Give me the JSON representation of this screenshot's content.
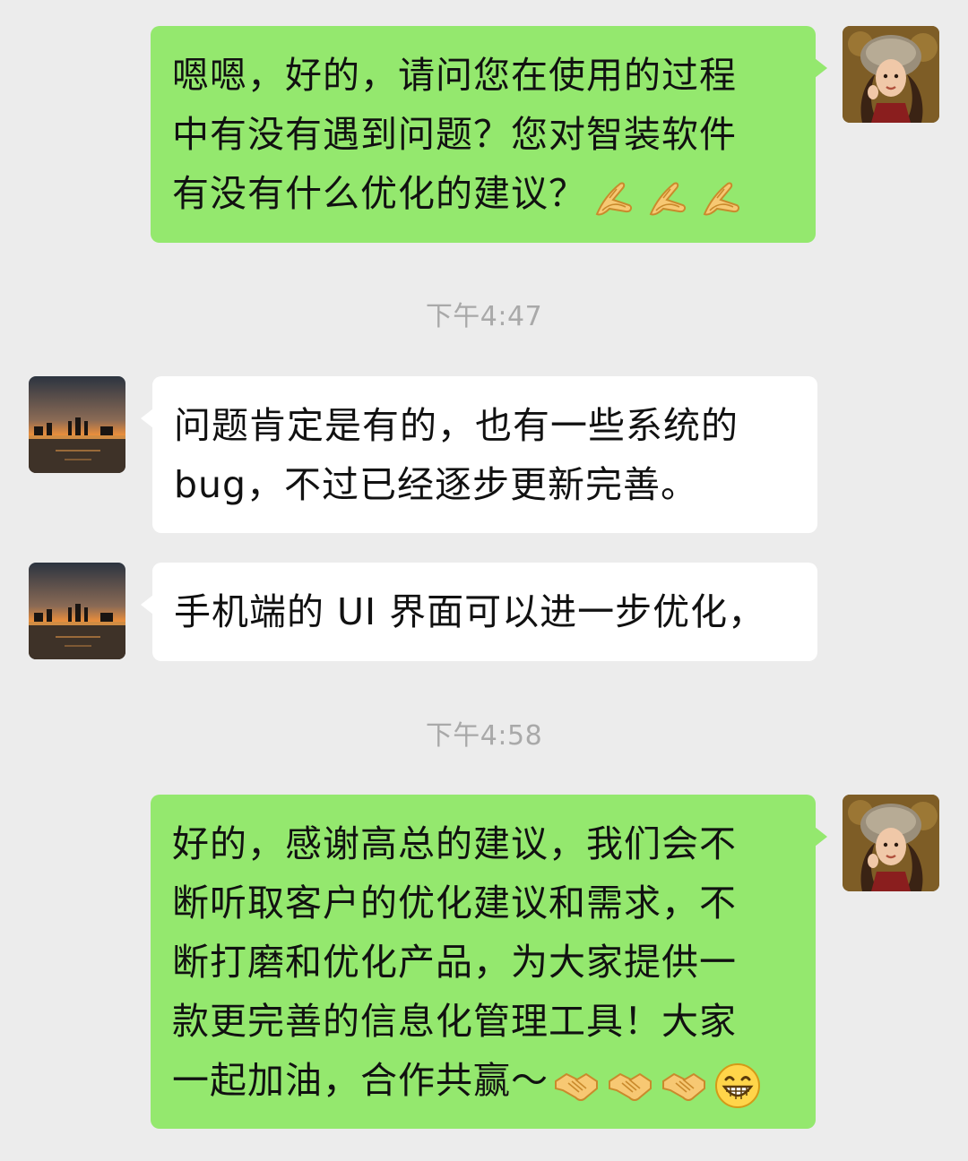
{
  "chat": {
    "messages": [
      {
        "sender": "me",
        "avatar": "lady-portrait-avatar",
        "lines": [
          "嗯嗯，好的，请问您在使用的过程",
          "中有没有遇到问题？您对智装软件",
          "有没有什么优化的建议？"
        ],
        "trailing_emojis": [
          "praying-hands-emoji",
          "praying-hands-emoji",
          "praying-hands-emoji"
        ]
      },
      {
        "timestamp": "下午4:47"
      },
      {
        "sender": "other",
        "avatar": "sunset-city-avatar",
        "lines": [
          "问题肯定是有的，也有一些系统的",
          "bug，不过已经逐步更新完善。"
        ]
      },
      {
        "sender": "other",
        "avatar": "sunset-city-avatar",
        "lines": [
          "手机端的 UI 界面可以进一步优化，"
        ]
      },
      {
        "timestamp": "下午4:58"
      },
      {
        "sender": "me",
        "avatar": "lady-portrait-avatar",
        "lines": [
          "好的，感谢高总的建议，我们会不",
          "断听取客户的优化建议和需求，不",
          "断打磨和优化产品，为大家提供一",
          "款更完善的信息化管理工具！大家",
          "一起加油，合作共赢～"
        ],
        "trailing_emojis": [
          "handshake-emoji",
          "handshake-emoji",
          "handshake-emoji",
          "grinning-face-emoji"
        ]
      }
    ]
  },
  "colors": {
    "background": "#ececec",
    "outgoing_bubble": "#94e86e",
    "incoming_bubble": "#ffffff",
    "timestamp_text": "#a9a9a9"
  }
}
